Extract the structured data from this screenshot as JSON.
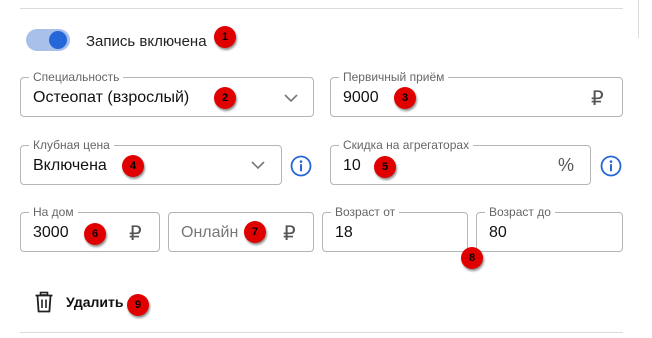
{
  "colors": {
    "accent": "#2566d9",
    "marker": "#e00000",
    "border": "#b5b5b5"
  },
  "booking": {
    "toggle_on": true,
    "label": "Запись включена"
  },
  "specialty": {
    "label": "Специальность",
    "value": "Остеопат (взрослый)"
  },
  "first_visit": {
    "label": "Первичный приём",
    "value": "9000",
    "currency": "₽"
  },
  "club_price": {
    "label": "Клубная цена",
    "value": "Включена"
  },
  "aggregator_discount": {
    "label": "Скидка на агрегаторах",
    "value": "10",
    "unit": "%"
  },
  "home_visit": {
    "label": "На дом",
    "value": "3000",
    "currency": "₽"
  },
  "online": {
    "placeholder": "Онлайн",
    "currency": "₽"
  },
  "age_from": {
    "label": "Возраст от",
    "value": "18"
  },
  "age_to": {
    "label": "Возраст до",
    "value": "80"
  },
  "delete": {
    "label": "Удалить",
    "icon": "trash-icon"
  },
  "markers": [
    "1",
    "2",
    "3",
    "4",
    "5",
    "6",
    "7",
    "8",
    "9"
  ]
}
